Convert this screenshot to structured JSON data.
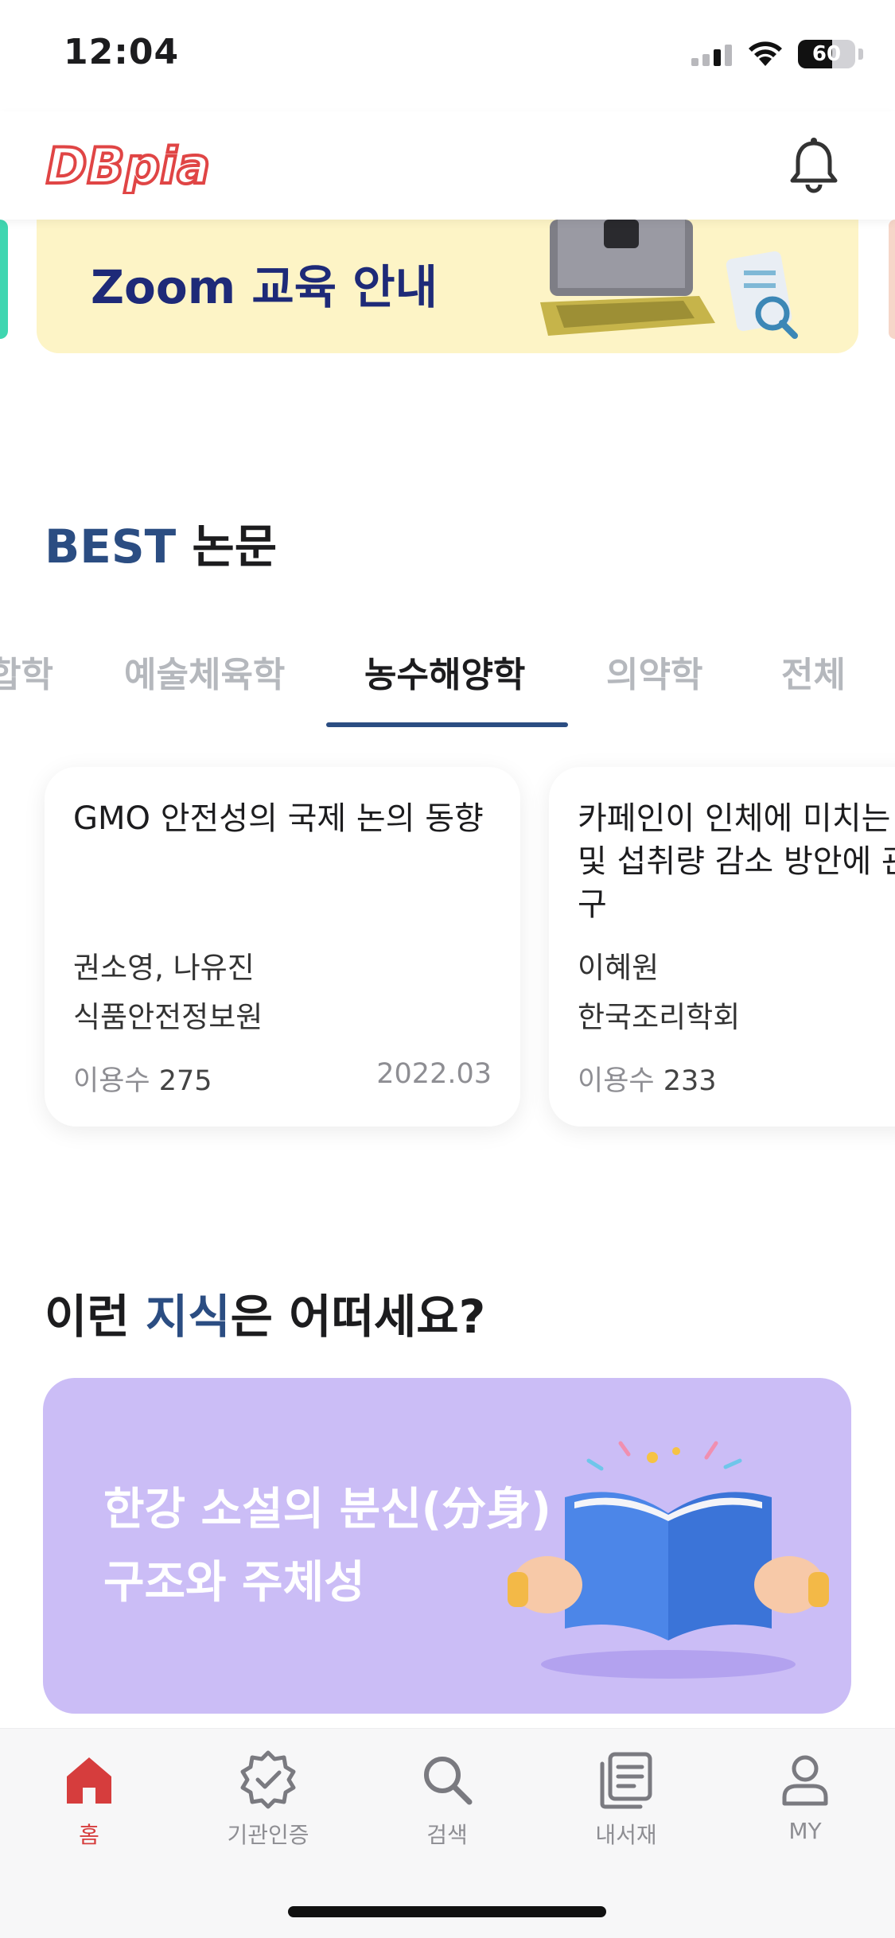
{
  "status_bar": {
    "time": "12:04",
    "battery": "60",
    "battery_level": 0.6,
    "icons": [
      "cellular-signal-icon",
      "wifi-icon",
      "battery-icon"
    ]
  },
  "header": {
    "logo_text": "DBpia",
    "brand_color": "#e04545",
    "notification_icon": "bell-icon"
  },
  "banner": {
    "title": "Zoom 교육 안내",
    "background": "#fdf4c6"
  },
  "best_section": {
    "title_accent": "BEST",
    "title_rest": " 논문",
    "accent_color": "#2b4d82",
    "tabs": [
      {
        "label": "합학",
        "active": false
      },
      {
        "label": "예술체육학",
        "active": false
      },
      {
        "label": "농수해양학",
        "active": true
      },
      {
        "label": "의약학",
        "active": false
      },
      {
        "label": "전체",
        "active": false
      }
    ],
    "cards": [
      {
        "title": "GMO 안전성의 국제 논의 동향",
        "authors": "권소영, 나유진",
        "publisher": "식품안전정보원",
        "views_label": "이용수",
        "views": "275",
        "date": "2022.03"
      },
      {
        "title": "카페인이 인체에 미치는 영향 및 섭취량 감소 방안에 관한 연구",
        "authors": "이혜원",
        "publisher": "한국조리학회",
        "views_label": "이용수",
        "views": "233",
        "date": ""
      }
    ]
  },
  "knowledge_section": {
    "title_prefix": "이런 ",
    "title_accent": "지식",
    "title_suffix": "은 어떠세요?",
    "card": {
      "line1": "한강 소설의 분신(分身)",
      "line2": "구조와 주체성",
      "background": "#cbbdf6"
    }
  },
  "bottom_nav": {
    "items": [
      {
        "label": "홈",
        "icon": "home-icon",
        "active": true
      },
      {
        "label": "기관인증",
        "icon": "verified-badge-icon",
        "active": false
      },
      {
        "label": "검색",
        "icon": "search-icon",
        "active": false
      },
      {
        "label": "내서재",
        "icon": "library-icon",
        "active": false
      },
      {
        "label": "MY",
        "icon": "person-icon",
        "active": false
      }
    ],
    "active_color": "#d63d3d"
  }
}
